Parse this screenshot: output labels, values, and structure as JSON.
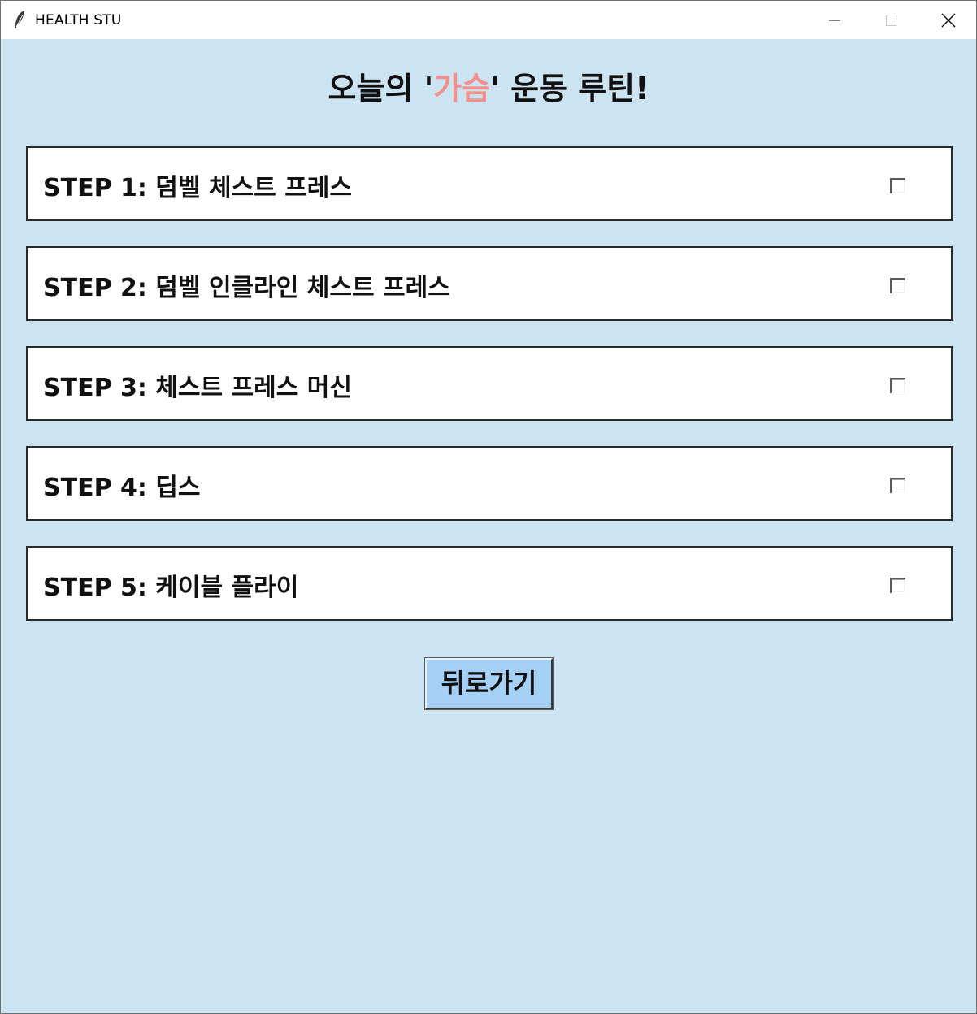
{
  "window": {
    "title": "HEALTH STU",
    "icons": [
      "feather-app-icon",
      "minimize-icon",
      "maximize-icon",
      "close-icon"
    ]
  },
  "heading": {
    "prefix": "오늘의 '",
    "highlight": "가슴",
    "suffix": "' 운동 루틴!",
    "highlight_color": "#f4908c"
  },
  "steps": [
    {
      "label": "STEP 1: 덤벨 체스트 프레스",
      "checked": false
    },
    {
      "label": "STEP 2: 덤벨 인클라인 체스트 프레스",
      "checked": false
    },
    {
      "label": "STEP 3: 체스트 프레스 머신",
      "checked": false
    },
    {
      "label": "STEP 4: 딥스",
      "checked": false
    },
    {
      "label": "STEP 5: 케이블 플라이",
      "checked": false
    }
  ],
  "back_button": {
    "label": "뒤로가기"
  },
  "colors": {
    "background": "#cce3f1",
    "button": "#a6d1f6",
    "row": "#ffffff"
  }
}
